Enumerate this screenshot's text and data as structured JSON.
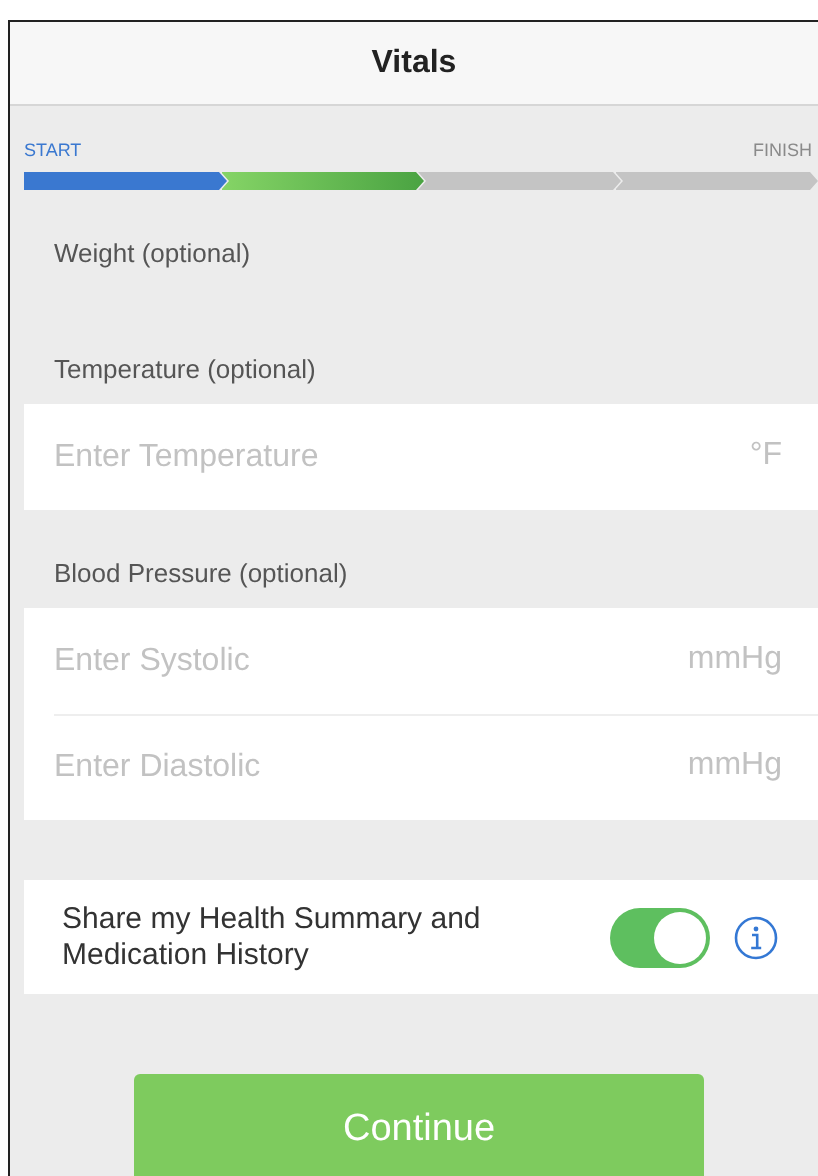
{
  "header": {
    "title": "Vitals"
  },
  "progress": {
    "start_label": "START",
    "finish_label": "FINISH",
    "steps": [
      {
        "complete": true,
        "current": false
      },
      {
        "complete": false,
        "current": true
      },
      {
        "complete": false,
        "current": false
      },
      {
        "complete": false,
        "current": false
      }
    ]
  },
  "sections": [
    {
      "label": "Weight (optional)"
    },
    {
      "label": "Temperature (optional)",
      "fields": [
        {
          "placeholder": "Enter Temperature",
          "unit": "°F"
        }
      ]
    },
    {
      "label": "Blood Pressure (optional)",
      "fields": [
        {
          "placeholder": "Enter Systolic",
          "unit": "mmHg"
        },
        {
          "placeholder": "Enter Diastolic",
          "unit": "mmHg"
        }
      ]
    }
  ],
  "share": {
    "label": "Share my Health Summary and Medication History",
    "on": true
  },
  "continue_button": "Continue"
}
